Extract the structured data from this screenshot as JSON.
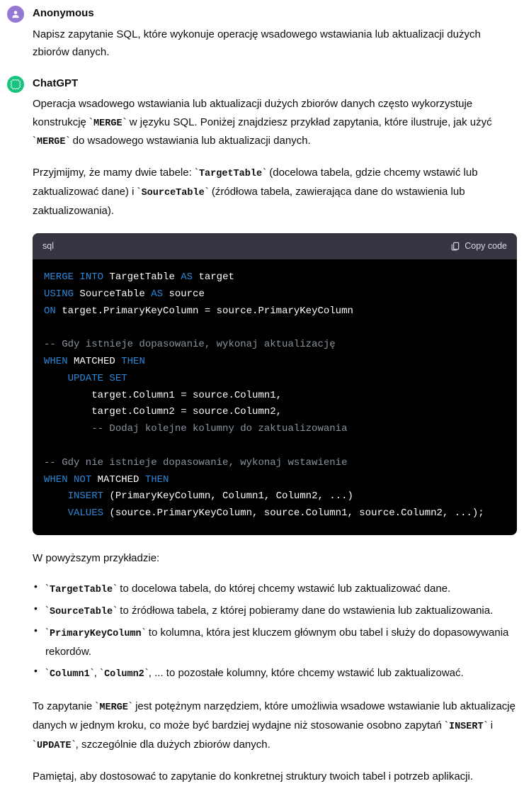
{
  "messages": {
    "anon": {
      "author": "Anonymous",
      "text": "Napisz zapytanie SQL, które wykonuje operację wsadowego wstawiania lub aktualizacji dużych zbiorów danych."
    },
    "gpt": {
      "author": "ChatGPT",
      "intro1a": "Operacja wsadowego wstawiania lub aktualizacji dużych zbiorów danych często wykorzystuje konstrukcję ",
      "merge1": "MERGE",
      "intro1b": " w języku SQL. Poniżej znajdziesz przykład zapytania, które ilustruje, jak użyć ",
      "merge2": "MERGE",
      "intro1c": " do wsadowego wstawiania lub aktualizacji danych.",
      "intro2a": "Przyjmijmy, że mamy dwie tabele: ",
      "tgt1": "TargetTable",
      "intro2b": " (docelowa tabela, gdzie chcemy wstawić lub zaktualizować dane) i ",
      "src1": "SourceTable",
      "intro2c": " (źródłowa tabela, zawierająca dane do wstawienia lub zaktualizowania).",
      "codelang": "sql",
      "copylabel": "Copy code",
      "code": {
        "l1": {
          "a": "MERGE",
          "b": " INTO",
          "c": " TargetTable ",
          "d": "AS",
          "e": " target"
        },
        "l2": {
          "a": "USING",
          "b": " SourceTable ",
          "c": "AS",
          "d": " source"
        },
        "l3": {
          "a": "ON",
          "b": " target.PrimaryKeyColumn = source.PrimaryKeyColumn"
        },
        "l5": "-- Gdy istnieje dopasowanie, wykonaj aktualizację",
        "l6": {
          "a": "WHEN",
          "b": " MATCHED ",
          "c": "THEN"
        },
        "l7": {
          "a": "    UPDATE",
          "b": " SET"
        },
        "l8": "        target.Column1 = source.Column1,",
        "l9": "        target.Column2 = source.Column2,",
        "l10": "        -- Dodaj kolejne kolumny do zaktualizowania",
        "l12": "-- Gdy nie istnieje dopasowanie, wykonaj wstawienie",
        "l13": {
          "a": "WHEN",
          "b": " NOT",
          "c": " MATCHED ",
          "d": "THEN"
        },
        "l14": {
          "a": "    INSERT",
          "b": " (PrimaryKeyColumn, Column1, Column2, ...)"
        },
        "l15": {
          "a": "    VALUES",
          "b": " (source.PrimaryKeyColumn, source.Column1, source.Column2, ...);"
        }
      },
      "after_code_heading": "W powyższym przykładzie:",
      "bullet1": {
        "code": "TargetTable",
        "text": " to docelowa tabela, do której chcemy wstawić lub zaktualizować dane."
      },
      "bullet2": {
        "code": "SourceTable",
        "text": " to źródłowa tabela, z której pobieramy dane do wstawienia lub zaktualizowania."
      },
      "bullet3": {
        "code": "PrimaryKeyColumn",
        "text": " to kolumna, która jest kluczem głównym obu tabel i służy do dopasowywania rekordów."
      },
      "bullet4": {
        "code1": "Column1",
        "sep": ", ",
        "code2": "Column2",
        "text": ", ... to pozostałe kolumny, które chcemy wstawić lub zaktualizować."
      },
      "outro1a": "To zapytanie ",
      "outro1merge": "MERGE",
      "outro1b": " jest potężnym narzędziem, które umożliwia wsadowe wstawianie lub aktualizację danych w jednym kroku, co może być bardziej wydajne niż stosowanie osobno zapytań ",
      "outro1insert": "INSERT",
      "outro1c": " i ",
      "outro1update": "UPDATE",
      "outro1d": ", szczególnie dla dużych zbiorów danych.",
      "outro2": "Pamiętaj, aby dostosować to zapytanie do konkretnej struktury twoich tabel i potrzeb aplikacji."
    }
  }
}
